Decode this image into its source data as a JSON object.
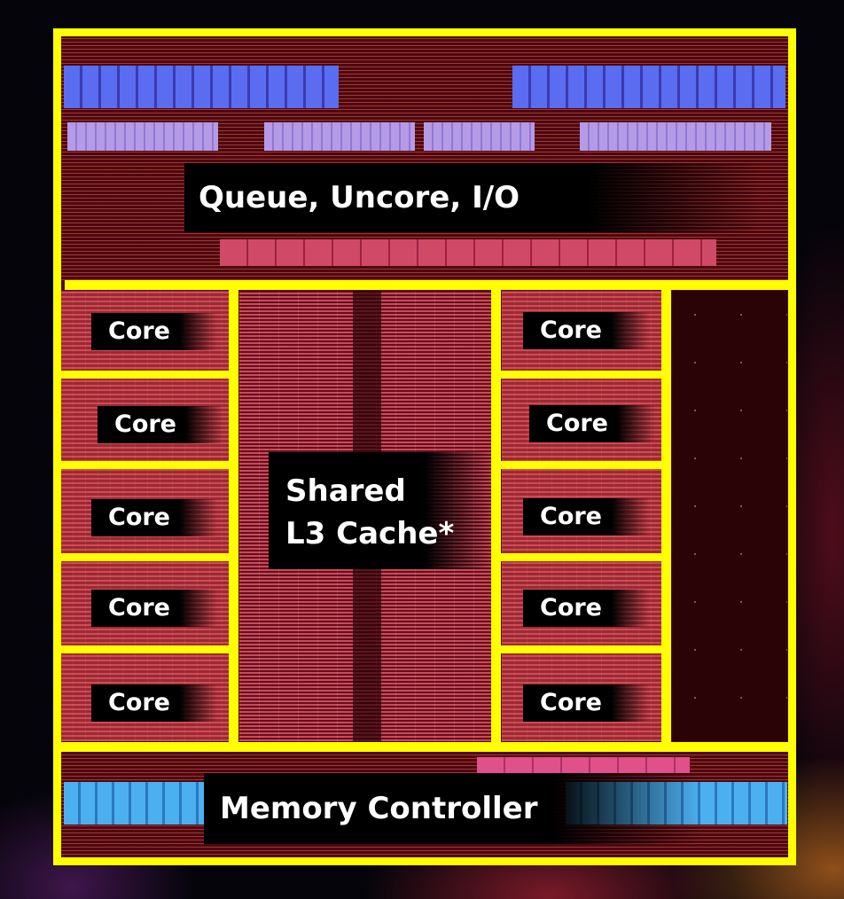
{
  "diagram": {
    "type": "cpu-die-floorplan",
    "border_color": "#ffff00",
    "label_background": "#000000",
    "label_text_color": "#ffffff",
    "regions": {
      "uncore": {
        "label": "Queue, Uncore, I/O"
      },
      "l3_cache": {
        "label_line1": "Shared",
        "label_line2": "L3 Cache*"
      },
      "memory_controller": {
        "label": "Memory Controller"
      },
      "left_cores": [
        {
          "label": "Core"
        },
        {
          "label": "Core"
        },
        {
          "label": "Core"
        },
        {
          "label": "Core"
        },
        {
          "label": "Core"
        }
      ],
      "right_cores": [
        {
          "label": "Core"
        },
        {
          "label": "Core"
        },
        {
          "label": "Core"
        },
        {
          "label": "Core"
        },
        {
          "label": "Core"
        }
      ]
    }
  }
}
